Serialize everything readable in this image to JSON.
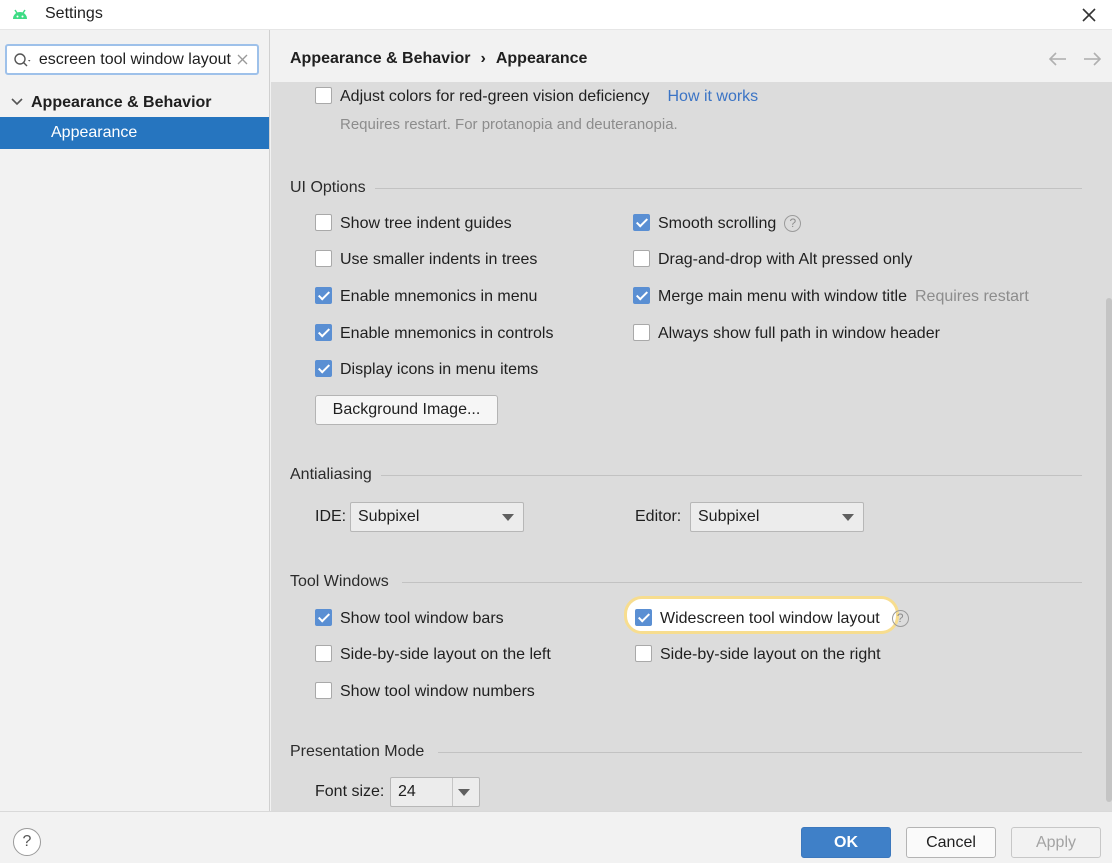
{
  "window": {
    "title": "Settings",
    "app_icon": "android-icon",
    "close_icon": "close-icon"
  },
  "sidebar": {
    "search": {
      "value": "Widescreen tool window layout",
      "icon": "search-icon",
      "clear_icon": "clear-icon"
    },
    "tree": {
      "parent": "Appearance & Behavior",
      "child": "Appearance"
    }
  },
  "header": {
    "breadcrumb": [
      "Appearance & Behavior",
      "›",
      "Appearance"
    ]
  },
  "top": {
    "red_green": {
      "label": "Adjust colors for red-green vision deficiency",
      "checked": false
    },
    "how_it_works": "How it works",
    "restart_note": "Requires restart. For protanopia and deuteranopia."
  },
  "ui_options": {
    "title": "UI Options",
    "left": [
      {
        "label": "Show tree indent guides",
        "checked": false
      },
      {
        "label": "Use smaller indents in trees",
        "checked": false
      },
      {
        "label": "Enable mnemonics in menu",
        "checked": true
      },
      {
        "label": "Enable mnemonics in controls",
        "checked": true
      },
      {
        "label": "Display icons in menu items",
        "checked": true
      }
    ],
    "right": [
      {
        "label": "Smooth scrolling",
        "checked": true
      },
      {
        "label": "Drag-and-drop with Alt pressed only",
        "checked": false
      },
      {
        "label": "Merge main menu with window title",
        "checked": true,
        "note": "Requires restart"
      },
      {
        "label": "Always show full path in window header",
        "checked": false
      }
    ],
    "background_button": "Background Image..."
  },
  "antialiasing": {
    "title": "Antialiasing",
    "ide_label": "IDE:",
    "ide_value": "Subpixel",
    "editor_label": "Editor:",
    "editor_value": "Subpixel"
  },
  "tool_windows": {
    "title": "Tool Windows",
    "left": [
      {
        "label": "Show tool window bars",
        "checked": true
      },
      {
        "label": "Side-by-side layout on the left",
        "checked": false
      },
      {
        "label": "Show tool window numbers",
        "checked": false
      }
    ],
    "right": [
      {
        "label": "Widescreen tool window layout",
        "checked": true
      },
      {
        "label": "Side-by-side layout on the right",
        "checked": false
      }
    ]
  },
  "presentation": {
    "title": "Presentation Mode",
    "font_label": "Font size:",
    "font_value": "24"
  },
  "footer": {
    "help": "?",
    "ok": "OK",
    "cancel": "Cancel",
    "apply": "Apply"
  },
  "colors": {
    "accent": "#2675bf",
    "checkbox_checked": "#5a8fd3",
    "link": "#3b74c5",
    "highlight_ring": "#f7dd8f"
  }
}
